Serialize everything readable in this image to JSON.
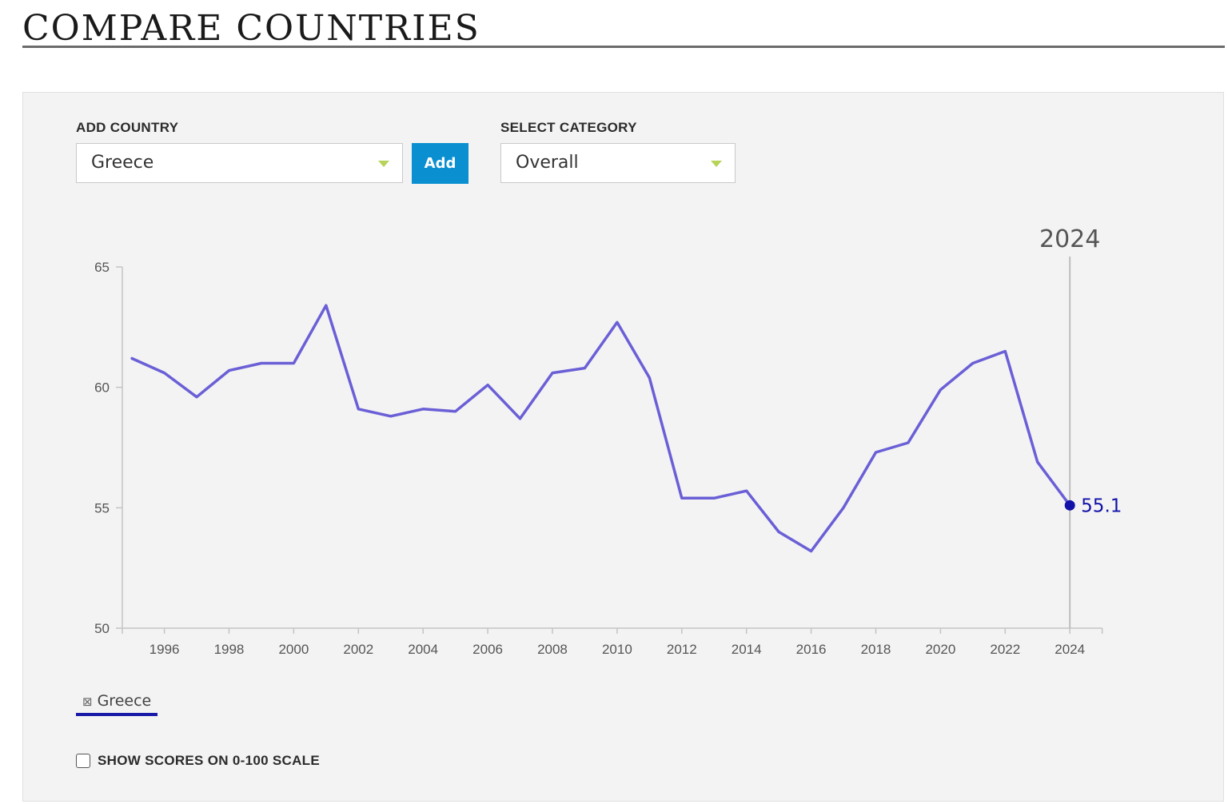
{
  "page": {
    "title": "COMPARE COUNTRIES"
  },
  "controls": {
    "add_country_label": "ADD COUNTRY",
    "country_value": "Greece",
    "add_button_label": "Add",
    "select_category_label": "SELECT CATEGORY",
    "category_value": "Overall",
    "scale_toggle_label": "SHOW SCORES ON 0-100 SCALE",
    "scale_toggle_checked": false
  },
  "legend": {
    "items": [
      {
        "label": "Greece",
        "icon": "box-x-icon",
        "color": "#1a1aa8"
      }
    ]
  },
  "colors": {
    "line": "#6a5fd6",
    "highlight_point": "#1212a8",
    "add_button": "#0a8fd1",
    "caret": "#b6d35a",
    "panel_bg": "#f3f3f3"
  },
  "chart_data": {
    "type": "line",
    "title": "",
    "xlabel": "",
    "ylabel": "",
    "x": [
      1995,
      1996,
      1997,
      1998,
      1999,
      2000,
      2001,
      2002,
      2003,
      2004,
      2005,
      2006,
      2007,
      2008,
      2009,
      2010,
      2011,
      2012,
      2013,
      2014,
      2015,
      2016,
      2017,
      2018,
      2019,
      2020,
      2021,
      2022,
      2023,
      2024
    ],
    "series": [
      {
        "name": "Greece",
        "values": [
          61.2,
          60.6,
          59.6,
          60.7,
          61.0,
          61.0,
          63.4,
          59.1,
          58.8,
          59.1,
          59.0,
          60.1,
          58.7,
          60.6,
          60.8,
          62.7,
          60.4,
          55.4,
          55.4,
          55.7,
          54.0,
          53.2,
          55.0,
          57.3,
          57.7,
          59.9,
          61.0,
          61.5,
          56.9,
          55.1
        ]
      }
    ],
    "ylim": [
      50,
      65
    ],
    "xlim": [
      1994,
      2025
    ],
    "y_ticks": [
      50,
      55,
      60,
      65
    ],
    "x_ticks": [
      1996,
      1998,
      2000,
      2002,
      2004,
      2006,
      2008,
      2010,
      2012,
      2014,
      2016,
      2018,
      2020,
      2022,
      2024
    ],
    "grid": false,
    "highlight": {
      "year": 2024,
      "year_label": "2024",
      "value_label": "55.1"
    },
    "legend_position": "bottom-left"
  }
}
